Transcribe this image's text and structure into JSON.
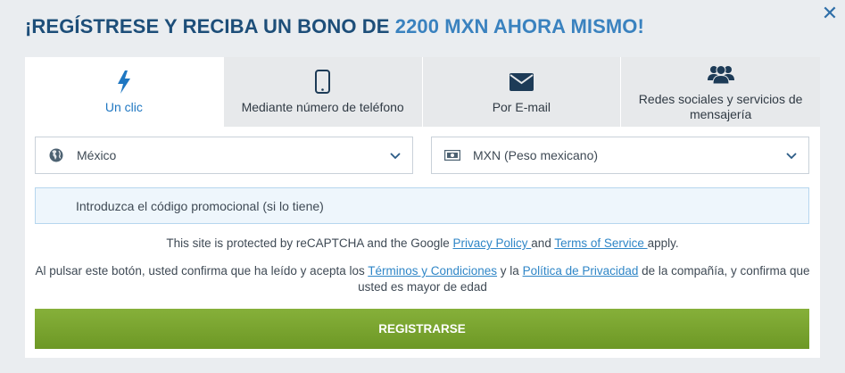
{
  "headline": {
    "prefix": "¡REGÍSTRESE Y RECIBA UN BONO DE ",
    "amount": "2200 MXN AHORA MISMO!"
  },
  "close_label": "✕",
  "tabs": [
    {
      "label": "Un clic",
      "icon": "lightning-icon",
      "active": true
    },
    {
      "label": "Mediante número de teléfono",
      "icon": "phone-icon",
      "active": false
    },
    {
      "label": "Por E-mail",
      "icon": "envelope-icon",
      "active": false
    },
    {
      "label": "Redes sociales y servicios de mensajería",
      "icon": "users-icon",
      "active": false
    }
  ],
  "country_select": {
    "value": "México",
    "icon": "globe-icon"
  },
  "currency_select": {
    "value": "MXN (Peso mexicano)",
    "icon": "banknote-icon"
  },
  "promo": {
    "placeholder": "Introduzca el código promocional (si lo tiene)"
  },
  "recaptcha": {
    "text_before": "This site is protected by reCAPTCHA and the Google ",
    "privacy_link": "Privacy Policy ",
    "and": "and ",
    "terms_link": "Terms of Service ",
    "text_after": "apply."
  },
  "terms": {
    "text_1": "Al pulsar este botón, usted confirma que ha leído y acepta los ",
    "terms_link": "Términos y Condiciones",
    "text_2": " y la ",
    "privacy_link": "Política de Privacidad",
    "text_3": " de la compañía, y confirma que usted es mayor de edad"
  },
  "register_button": "REGISTRARSE",
  "colors": {
    "headline": "#1d4e79",
    "accent": "#3a82bf",
    "active_tab": "#1f77c2",
    "button": "#7aa32f",
    "link": "#2f86c7"
  }
}
